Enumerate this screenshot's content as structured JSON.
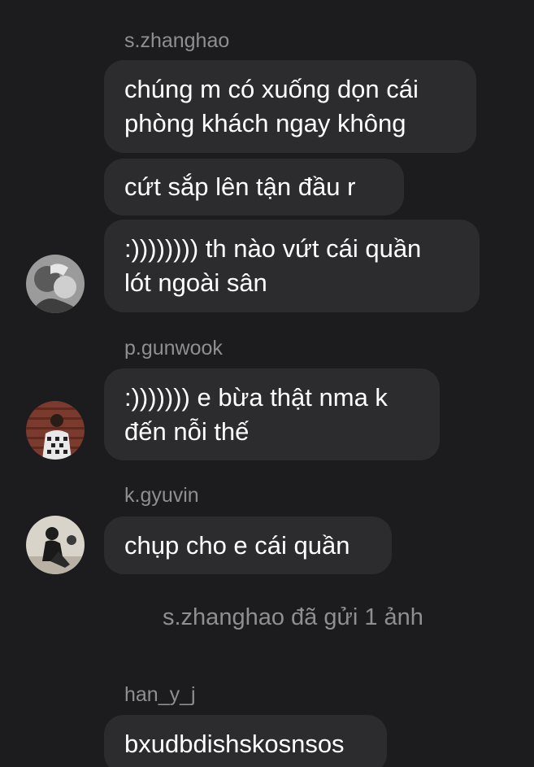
{
  "groups": [
    {
      "sender": "s.zhanghao",
      "messages": [
        "chúng m có xuống dọn cái\nphòng khách ngay không",
        "cứt sắp lên tận đầu r",
        ":)))))))) th nào vứt cái quần\nlót ngoài sân"
      ],
      "avatar": "user-avatar-s-zhanghao"
    },
    {
      "sender": "p.gunwook",
      "messages": [
        ":))))))) e bừa thật nma k\nđến nỗi thế"
      ],
      "avatar": "user-avatar-p-gunwook"
    },
    {
      "sender": "k.gyuvin",
      "messages": [
        "chụp cho e cái quần"
      ],
      "avatar": "user-avatar-k-gyuvin"
    },
    {
      "sender": "han_y_j",
      "messages": [
        "bxudbdishskosnsos"
      ]
    }
  ],
  "system_message": "s.zhanghao đã gửi 1 ảnh",
  "colors": {
    "background": "#1c1c1e",
    "bubble": "#2c2c2e",
    "sender_text": "#8e8e93",
    "message_text": "#ffffff"
  }
}
